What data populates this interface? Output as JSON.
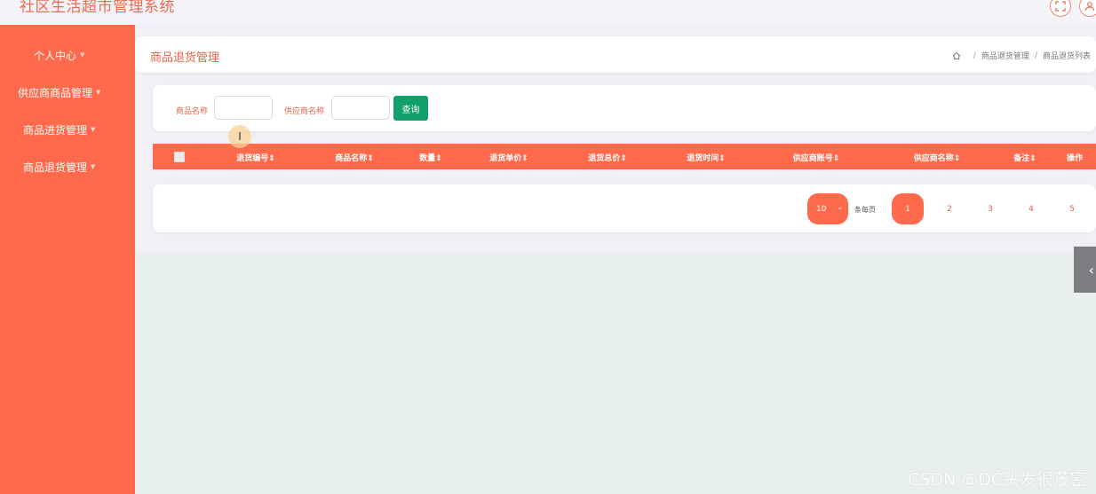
{
  "header": {
    "app_title": "社区生活超市管理系统",
    "icons": [
      "fullscreen-icon",
      "user-icon"
    ]
  },
  "sidebar": {
    "items": [
      {
        "label": "个人中心"
      },
      {
        "label": "供应商商品管理"
      },
      {
        "label": "商品进货管理"
      },
      {
        "label": "商品退货管理"
      }
    ]
  },
  "main": {
    "page_title": "商品退货管理",
    "breadcrumb": [
      "商品退货管理",
      "商品退货列表"
    ]
  },
  "filters": {
    "product_name_label": "商品名称",
    "product_name_value": "",
    "supplier_name_label": "供应商名称",
    "supplier_name_value": "",
    "query_button": "查询"
  },
  "table": {
    "columns": [
      "退货编号",
      "商品名称",
      "数量",
      "退货单价",
      "退货总价",
      "退货时间",
      "供应商账号",
      "供应商名称",
      "备注",
      "操作"
    ],
    "rows": []
  },
  "pagination": {
    "page_size": "10",
    "page_size_suffix": "条每页",
    "pages": [
      "1",
      "2",
      "3",
      "4",
      "5"
    ],
    "current_page": "1"
  },
  "watermark": "CSDN @DC头发很茂密",
  "colors": {
    "accent": "#ff6a4c",
    "query_button": "#12a06a",
    "content_bg": "#e7f0eb"
  }
}
